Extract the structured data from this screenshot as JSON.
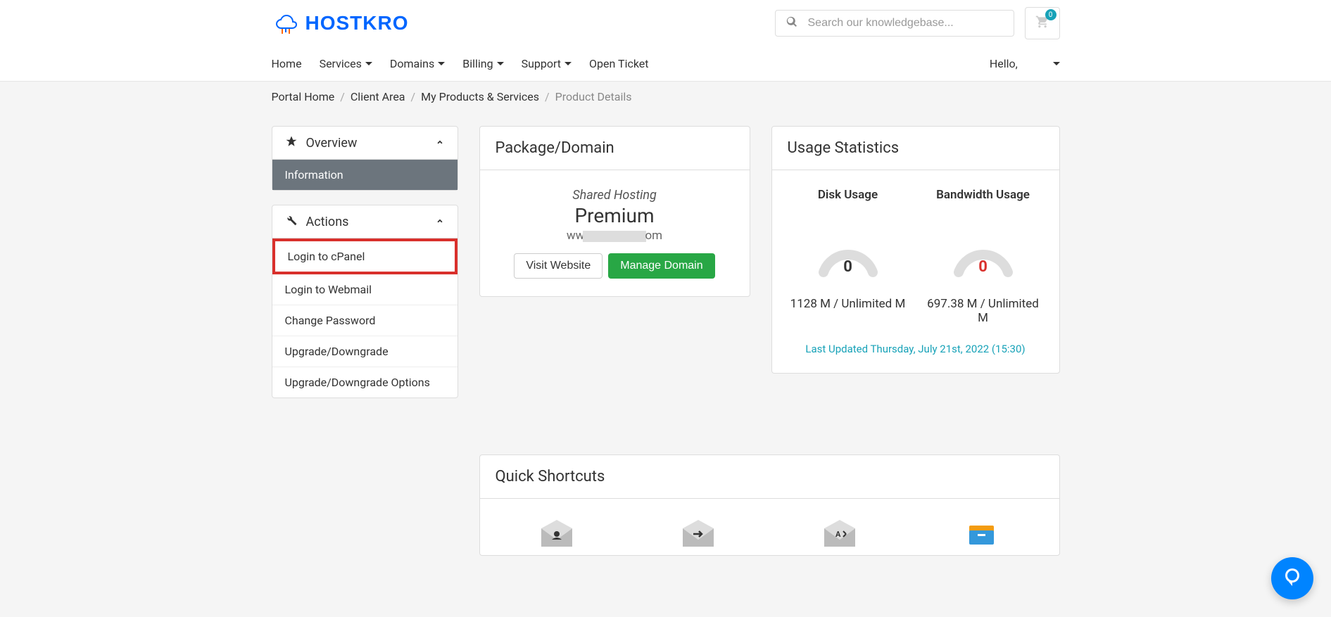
{
  "header": {
    "logo_text": "HOSTKRO",
    "search_placeholder": "Search our knowledgebase...",
    "cart_count": "0"
  },
  "nav": {
    "home": "Home",
    "services": "Services",
    "domains": "Domains",
    "billing": "Billing",
    "support": "Support",
    "open_ticket": "Open Ticket",
    "hello": "Hello,"
  },
  "breadcrumb": {
    "portal_home": "Portal Home",
    "client_area": "Client Area",
    "my_products": "My Products & Services",
    "current": "Product Details"
  },
  "sidebar": {
    "overview": {
      "title": "Overview",
      "information": "Information"
    },
    "actions": {
      "title": "Actions",
      "items": [
        "Login to cPanel",
        "Login to Webmail",
        "Change Password",
        "Upgrade/Downgrade",
        "Upgrade/Downgrade Options"
      ]
    }
  },
  "package": {
    "title": "Package/Domain",
    "type": "Shared Hosting",
    "name": "Premium",
    "domain_prefix": "ww",
    "domain_suffix": "om",
    "visit_website": "Visit Website",
    "manage_domain": "Manage Domain"
  },
  "usage": {
    "title": "Usage Statistics",
    "disk": {
      "title": "Disk Usage",
      "value": "0",
      "detail": "1128 M / Unlimited M"
    },
    "bandwidth": {
      "title": "Bandwidth Usage",
      "value": "0",
      "detail": "697.38 M / Unlimited M"
    },
    "last_updated": "Last Updated Thursday, July 21st, 2022 (15:30)"
  },
  "shortcuts": {
    "title": "Quick Shortcuts"
  }
}
